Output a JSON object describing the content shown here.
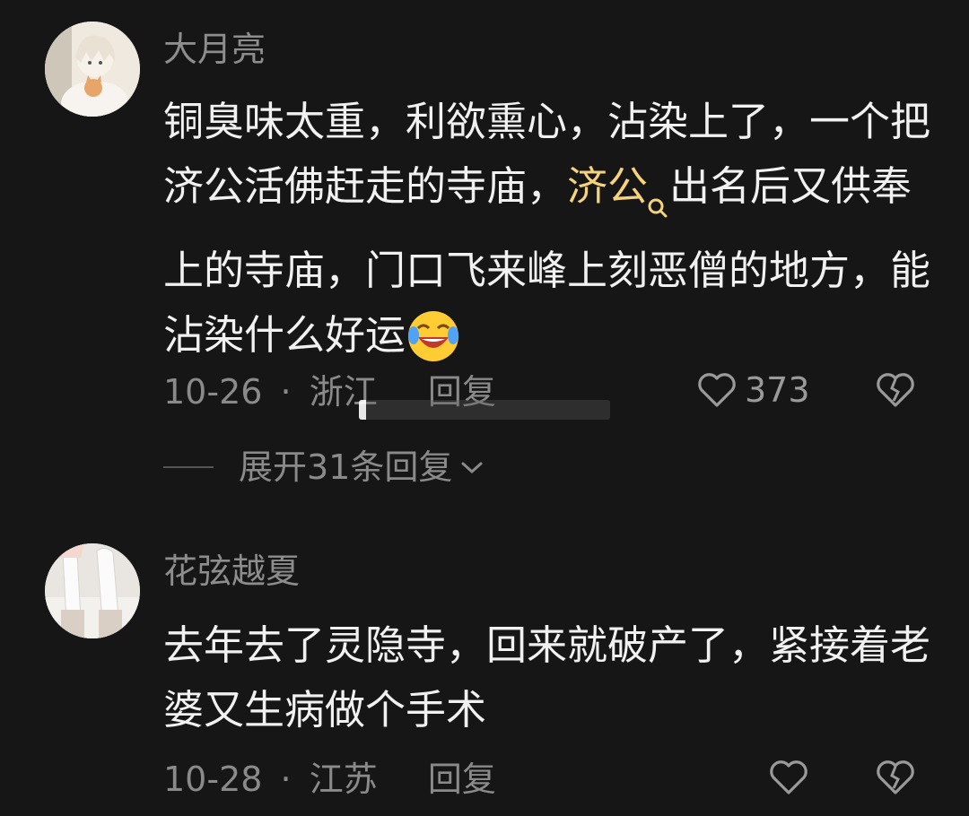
{
  "comments": [
    {
      "username": "大月亮",
      "text_before": "铜臭味太重，利欲熏心，沾染上了，一个把济公活佛赶走的寺庙，",
      "link": "济公",
      "text_after": "出名后又供奉上的寺庙，门口飞来峰上刻恶僧的地方，能沾染什么好运",
      "emoji": "laughing-crying-emoji",
      "date": "10-26",
      "location": "浙江",
      "reply_label": "回复",
      "likes": "373",
      "expand_label": "展开31条回复"
    },
    {
      "username": "花弦越夏",
      "text": "去年去了灵隐寺，回来就破产了，紧接着老婆又生病做个手术",
      "date": "10-28",
      "location": "江苏",
      "reply_label": "回复",
      "likes": ""
    }
  ],
  "separator": "·",
  "colors": {
    "background": "#161616",
    "text": "#f1f1f1",
    "muted": "#8a8a8a",
    "link": "#f4d37c"
  },
  "icons": [
    "search-icon",
    "heart-icon",
    "broken-heart-icon",
    "chevron-down-icon"
  ]
}
